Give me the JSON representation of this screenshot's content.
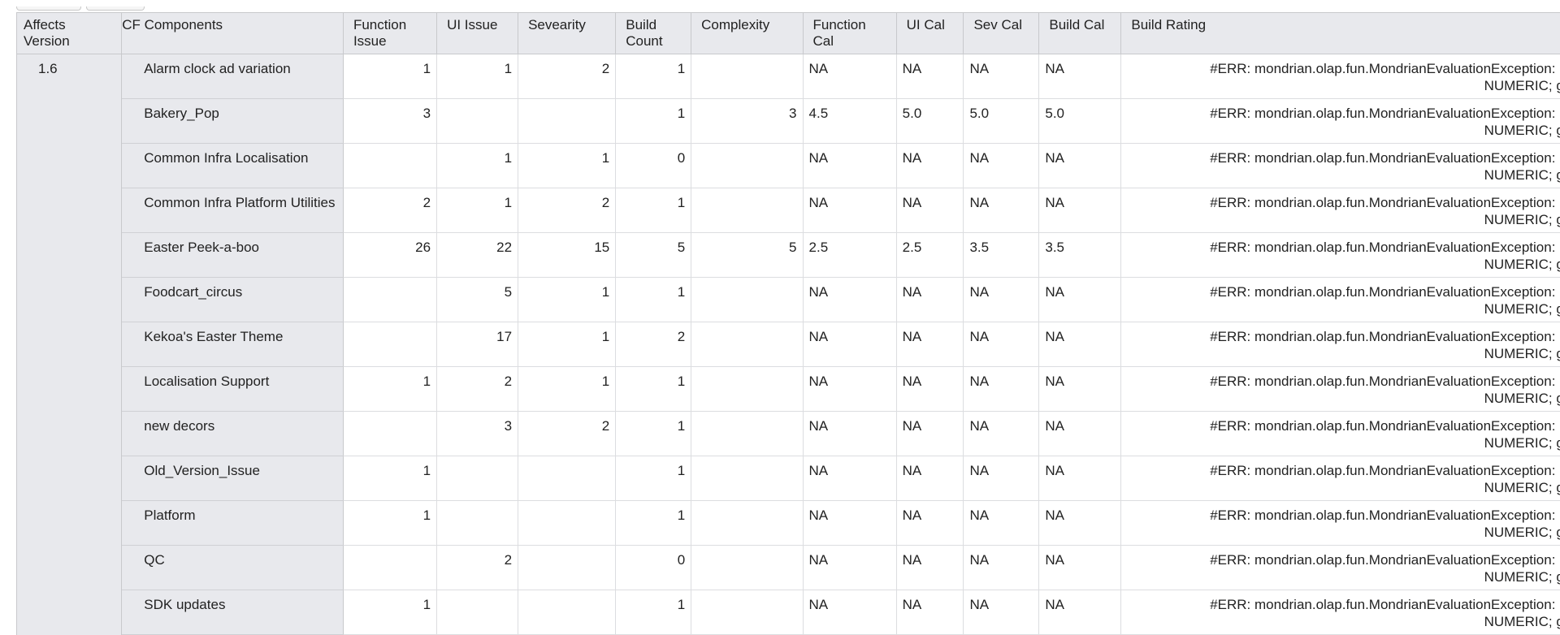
{
  "columns": {
    "affects_version": "Affects Version",
    "cf_components": "CF Components",
    "function_issue": "Function Issue",
    "ui_issue": "UI Issue",
    "sevearity": "Sevearity",
    "build_count": "Build Count",
    "complexity": "Complexity",
    "function_cal": "Function Cal",
    "ui_cal": "UI Cal",
    "sev_cal": "Sev Cal",
    "build_cal": "Build Cal",
    "build_rating": "Build Rating"
  },
  "version": "1.6",
  "error_line1": "#ERR: mondrian.olap.fun.MondrianEvaluationException: Ex",
  "error_line2": "NUMERIC; got",
  "rows": [
    {
      "name": "Alarm clock ad variation",
      "fi": "1",
      "ui": "1",
      "sev": "2",
      "bc": "1",
      "cx": "",
      "fc": "NA",
      "uc": "NA",
      "sc": "NA",
      "bcal": "NA"
    },
    {
      "name": "Bakery_Pop",
      "fi": "3",
      "ui": "",
      "sev": "",
      "bc": "1",
      "cx": "3",
      "fc": "4.5",
      "uc": "5.0",
      "sc": "5.0",
      "bcal": "5.0"
    },
    {
      "name": "Common Infra Localisation",
      "fi": "",
      "ui": "1",
      "sev": "1",
      "bc": "0",
      "cx": "",
      "fc": "NA",
      "uc": "NA",
      "sc": "NA",
      "bcal": "NA"
    },
    {
      "name": "Common Infra Platform Utilities",
      "fi": "2",
      "ui": "1",
      "sev": "2",
      "bc": "1",
      "cx": "",
      "fc": "NA",
      "uc": "NA",
      "sc": "NA",
      "bcal": "NA"
    },
    {
      "name": "Easter Peek-a-boo",
      "fi": "26",
      "ui": "22",
      "sev": "15",
      "bc": "5",
      "cx": "5",
      "fc": "2.5",
      "uc": "2.5",
      "sc": "3.5",
      "bcal": "3.5"
    },
    {
      "name": "Foodcart_circus",
      "fi": "",
      "ui": "5",
      "sev": "1",
      "bc": "1",
      "cx": "",
      "fc": "NA",
      "uc": "NA",
      "sc": "NA",
      "bcal": "NA"
    },
    {
      "name": "Kekoa's Easter Theme",
      "fi": "",
      "ui": "17",
      "sev": "1",
      "bc": "2",
      "cx": "",
      "fc": "NA",
      "uc": "NA",
      "sc": "NA",
      "bcal": "NA"
    },
    {
      "name": "Localisation Support",
      "fi": "1",
      "ui": "2",
      "sev": "1",
      "bc": "1",
      "cx": "",
      "fc": "NA",
      "uc": "NA",
      "sc": "NA",
      "bcal": "NA"
    },
    {
      "name": "new decors",
      "fi": "",
      "ui": "3",
      "sev": "2",
      "bc": "1",
      "cx": "",
      "fc": "NA",
      "uc": "NA",
      "sc": "NA",
      "bcal": "NA"
    },
    {
      "name": "Old_Version_Issue",
      "fi": "1",
      "ui": "",
      "sev": "",
      "bc": "1",
      "cx": "",
      "fc": "NA",
      "uc": "NA",
      "sc": "NA",
      "bcal": "NA"
    },
    {
      "name": "Platform",
      "fi": "1",
      "ui": "",
      "sev": "",
      "bc": "1",
      "cx": "",
      "fc": "NA",
      "uc": "NA",
      "sc": "NA",
      "bcal": "NA"
    },
    {
      "name": "QC",
      "fi": "",
      "ui": "2",
      "sev": "",
      "bc": "0",
      "cx": "",
      "fc": "NA",
      "uc": "NA",
      "sc": "NA",
      "bcal": "NA"
    },
    {
      "name": "SDK updates",
      "fi": "1",
      "ui": "",
      "sev": "",
      "bc": "1",
      "cx": "",
      "fc": "NA",
      "uc": "NA",
      "sc": "NA",
      "bcal": "NA"
    }
  ]
}
